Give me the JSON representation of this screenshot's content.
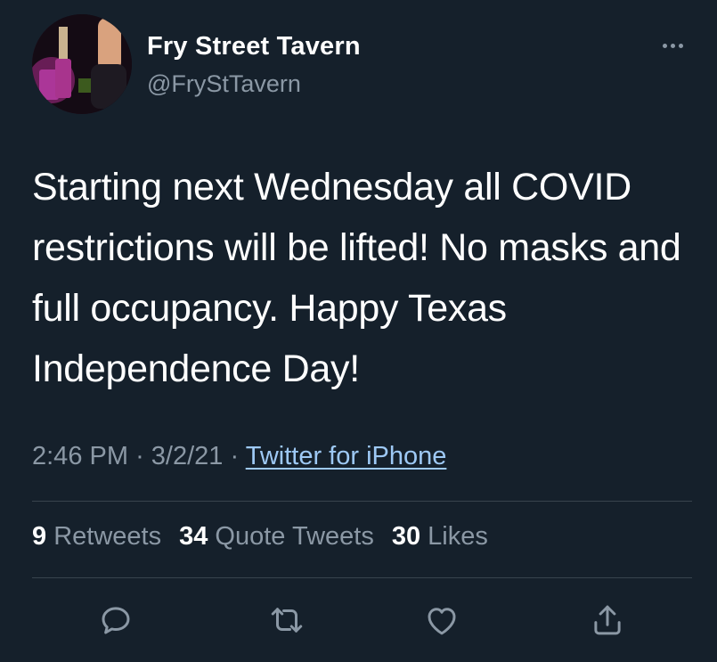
{
  "author": {
    "name": "Fry Street Tavern",
    "handle": "@FryStTavern",
    "avatar_icon": "avatar-photo"
  },
  "tweet": {
    "text": "Starting next Wednesday all COVID restrictions will be lifted! No masks and full occupancy. Happy Texas Independence Day!",
    "time": "2:46 PM",
    "date": "3/2/21",
    "separator": "·",
    "source": "Twitter for iPhone"
  },
  "stats": {
    "retweets_count": "9",
    "retweets_label": "Retweets",
    "quotes_count": "34",
    "quotes_label": "Quote Tweets",
    "likes_count": "30",
    "likes_label": "Likes"
  },
  "actions": [
    "reply-icon",
    "retweet-icon",
    "like-icon",
    "share-icon"
  ],
  "colors": {
    "background": "#15202b",
    "text": "#ffffff",
    "secondary": "#8b98a5",
    "link": "#9ec9f5",
    "divider": "#38444d"
  }
}
